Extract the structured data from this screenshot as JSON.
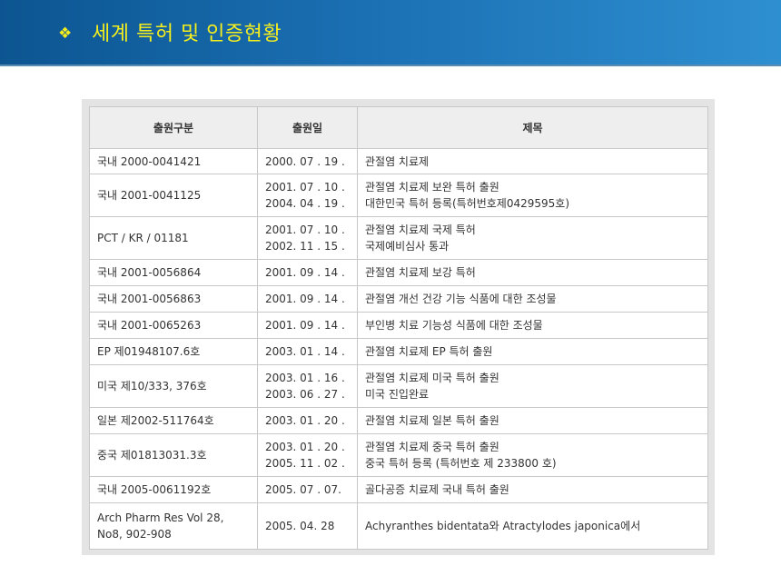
{
  "header": {
    "bullet": "❖",
    "title": "세계 특허 및 인증현황"
  },
  "table": {
    "columns": [
      "출원구분",
      "출원일",
      "제목"
    ],
    "rows": [
      {
        "type": [
          "국내 2000-0041421"
        ],
        "date": [
          "2000. 07 . 19 ."
        ],
        "title": [
          "관절염 치료제"
        ]
      },
      {
        "type": [
          "국내 2001-0041125"
        ],
        "date": [
          "2001. 07 . 10 .",
          "2004. 04 . 19 ."
        ],
        "title": [
          "관절염 치료제 보완 특허 출원",
          "대한민국 특허 등록(특허번호제0429595호)"
        ]
      },
      {
        "type": [
          "PCT / KR / 01181"
        ],
        "date": [
          "2001. 07 . 10 .",
          "2002. 11 . 15 ."
        ],
        "title": [
          "관절염 치료제 국제 특허",
          "국제예비심사 통과"
        ]
      },
      {
        "type": [
          "국내 2001-0056864"
        ],
        "date": [
          "2001. 09 . 14 ."
        ],
        "title": [
          "관절염 치료제 보강 특허"
        ]
      },
      {
        "type": [
          "국내 2001-0056863"
        ],
        "date": [
          "2001. 09 . 14 ."
        ],
        "title": [
          "관절염 개선 건강 기능 식품에 대한 조성물"
        ]
      },
      {
        "type": [
          "국내 2001-0065263"
        ],
        "date": [
          "2001. 09 . 14 ."
        ],
        "title": [
          "부인병 치료 기능성 식품에 대한 조성물"
        ]
      },
      {
        "type": [
          "EP 제01948107.6호"
        ],
        "date": [
          "2003. 01 . 14 ."
        ],
        "title": [
          "관절염 치료제 EP 특허 출원"
        ]
      },
      {
        "type": [
          "미국 제10/333, 376호"
        ],
        "date": [
          "2003. 01 . 16 .",
          "2003. 06 . 27 ."
        ],
        "title": [
          "관절염 치료제 미국 특허 출원",
          "미국 진입완료"
        ]
      },
      {
        "type": [
          "일본 제2002-511764호"
        ],
        "date": [
          "2003. 01 . 20 ."
        ],
        "title": [
          "관절염 치료제 일본 특허 출원"
        ]
      },
      {
        "type": [
          "중국 제01813031.3호"
        ],
        "date": [
          "2003. 01 . 20 .",
          "2005. 11 . 02 ."
        ],
        "title": [
          "관절염 치료제 중국 특허 출원",
          "중국 특허 등록 (특허번호 제 233800 호)"
        ]
      },
      {
        "type": [
          "국내 2005-0061192호"
        ],
        "date": [
          "2005. 07 . 07."
        ],
        "title": [
          "골다공증 치료제 국내 특허 출원"
        ]
      },
      {
        "type": [
          "Arch Pharm Res Vol 28,",
          "No8, 902-908"
        ],
        "date": [
          "2005. 04. 28"
        ],
        "title": [
          "Achyranthes bidentata와 Atractylodes japonica에서"
        ]
      }
    ]
  }
}
